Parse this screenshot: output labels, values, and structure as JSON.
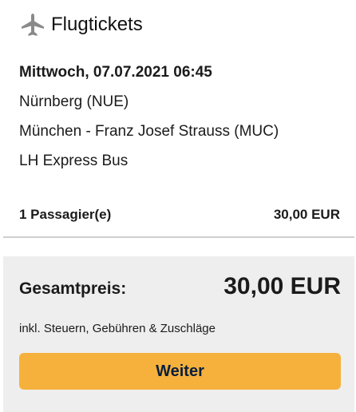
{
  "header": {
    "icon": "airplane-icon",
    "title": "Flugtickets"
  },
  "flight": {
    "datetime": "Mittwoch, 07.07.2021 06:45",
    "origin": "Nürnberg (NUE)",
    "destination": "München - Franz Josef Strauss (MUC)",
    "carrier": "LH Express Bus"
  },
  "passengers": {
    "label": "1 Passagier(e)",
    "price": "30,00 EUR"
  },
  "summary": {
    "total_label": "Gesamtpreis:",
    "total_value": "30,00 EUR",
    "tax_note": "inkl. Steuern, Gebühren & Zuschläge",
    "continue_label": "Weiter"
  },
  "colors": {
    "button": "#f5b13c",
    "summary_background": "#eeeeee",
    "icon": "#8a8a8a"
  }
}
